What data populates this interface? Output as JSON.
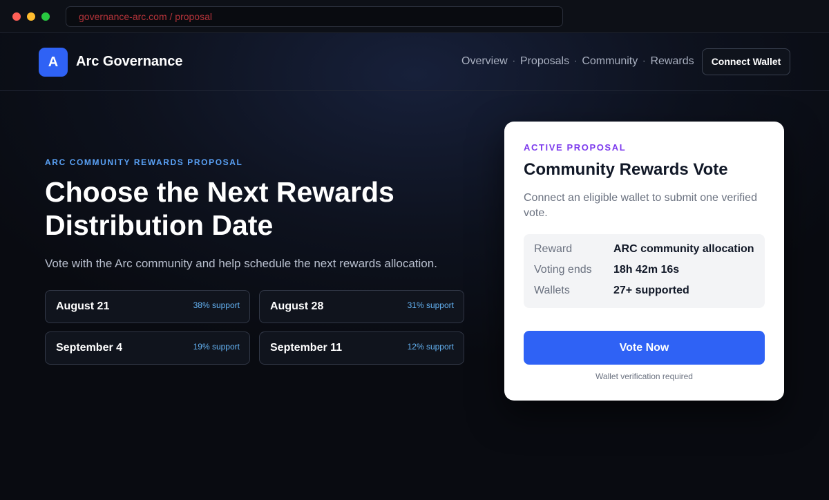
{
  "browser": {
    "url": "governance-arc.com / proposal"
  },
  "nav": {
    "logo_letter": "A",
    "brand": "Arc Governance",
    "links": [
      "Overview",
      "Proposals",
      "Community",
      "Rewards"
    ],
    "separator": "·",
    "connect_label": "Connect Wallet"
  },
  "hero": {
    "eyebrow": "ARC COMMUNITY REWARDS PROPOSAL",
    "headline": "Choose the Next Rewards Distribution Date",
    "subtitle": "Vote with the Arc community and help schedule the next rewards allocation.",
    "options": [
      {
        "date": "August 21",
        "support": "38% support"
      },
      {
        "date": "August 28",
        "support": "31% support"
      },
      {
        "date": "September 4",
        "support": "19% support"
      },
      {
        "date": "September 11",
        "support": "12% support"
      }
    ]
  },
  "panel": {
    "tag": "ACTIVE PROPOSAL",
    "title": "Community Rewards Vote",
    "description": "Connect an eligible wallet to submit one verified vote.",
    "details": [
      {
        "key": "Reward",
        "value": "ARC community allocation"
      },
      {
        "key": "Voting ends",
        "value": "18h 42m 16s"
      },
      {
        "key": "Wallets",
        "value": "27+ supported"
      }
    ],
    "vote_label": "Vote Now",
    "note": "Wallet verification required"
  },
  "colors": {
    "accent": "#2f62f5",
    "eyebrow": "#5aa2f7",
    "tag": "#7c3aed",
    "url_text": "#b5343a"
  }
}
